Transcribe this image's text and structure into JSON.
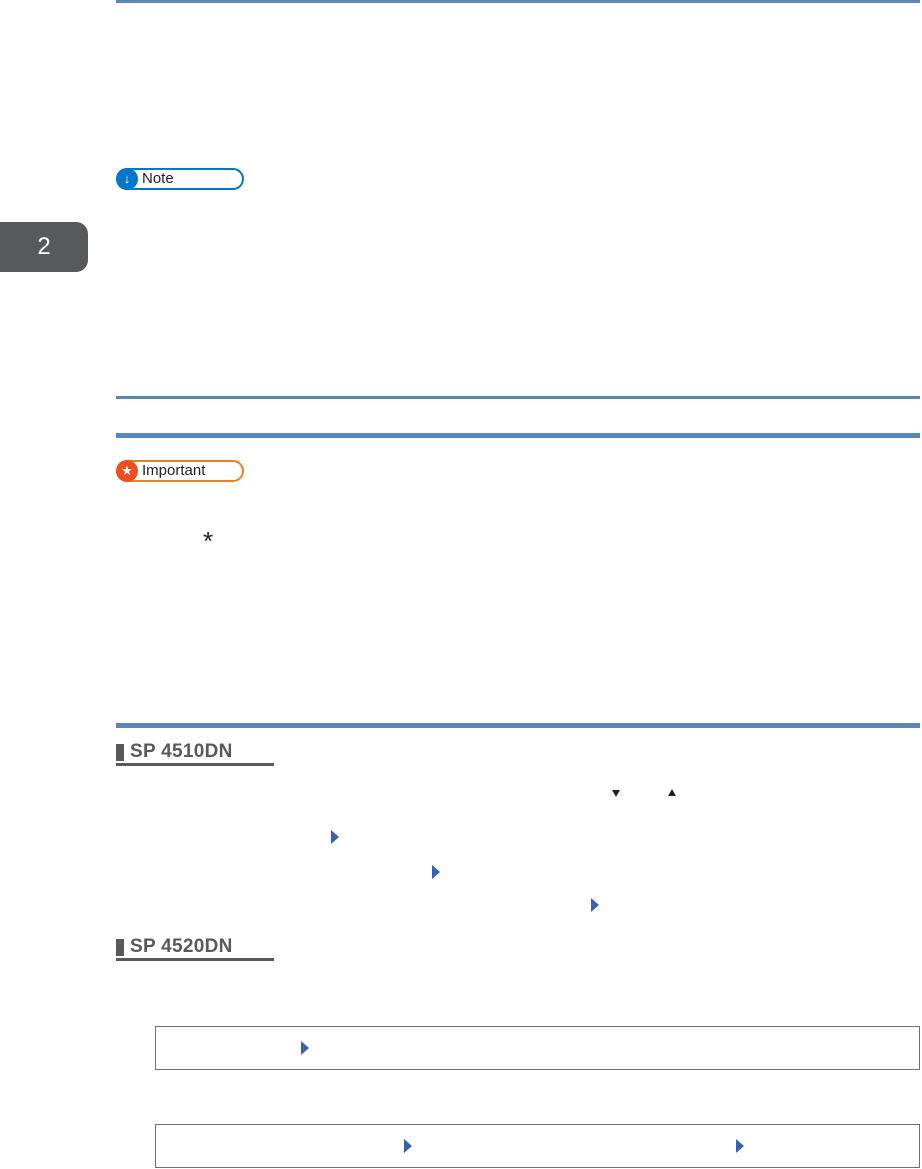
{
  "chapter": {
    "number": "2"
  },
  "callouts": {
    "note": {
      "label": "Note",
      "icon": "arrow-down-icon"
    },
    "important": {
      "label": "Important",
      "icon": "star-icon"
    }
  },
  "symbols": {
    "asterisk": "*"
  },
  "models": [
    {
      "name": "SP 4510DN"
    },
    {
      "name": "SP 4520DN"
    }
  ],
  "colors": {
    "rule": "#5b86b8",
    "note": "#0077c8",
    "important": "#ef7d22",
    "tab": "#58595b",
    "arrow": "#3a5fb0"
  }
}
